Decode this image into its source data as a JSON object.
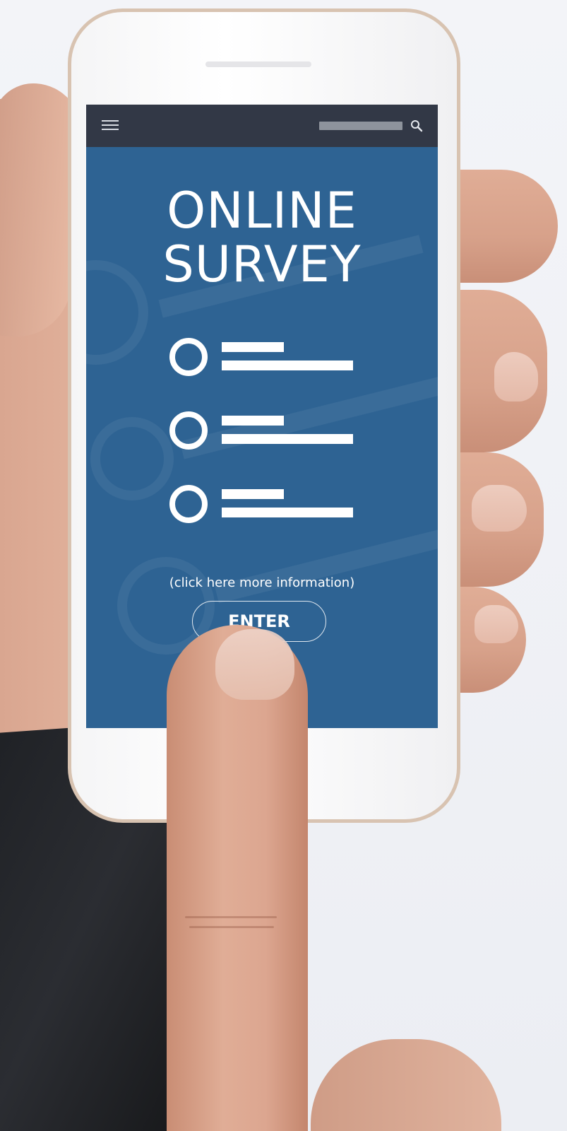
{
  "app": {
    "title_line1": "ONLINE",
    "title_line2": "SURVEY"
  },
  "topbar": {
    "menu_icon": "hamburger-menu-icon",
    "search_icon": "search-icon"
  },
  "survey": {
    "options": [
      {
        "icon": "radio-circle-icon"
      },
      {
        "icon": "radio-circle-icon"
      },
      {
        "icon": "radio-circle-icon"
      }
    ]
  },
  "info_text": "(click here more information)",
  "enter_label": "ENTER",
  "colors": {
    "screen_bg": "#2e6393",
    "topbar_bg": "#323846",
    "text": "#ffffff"
  }
}
